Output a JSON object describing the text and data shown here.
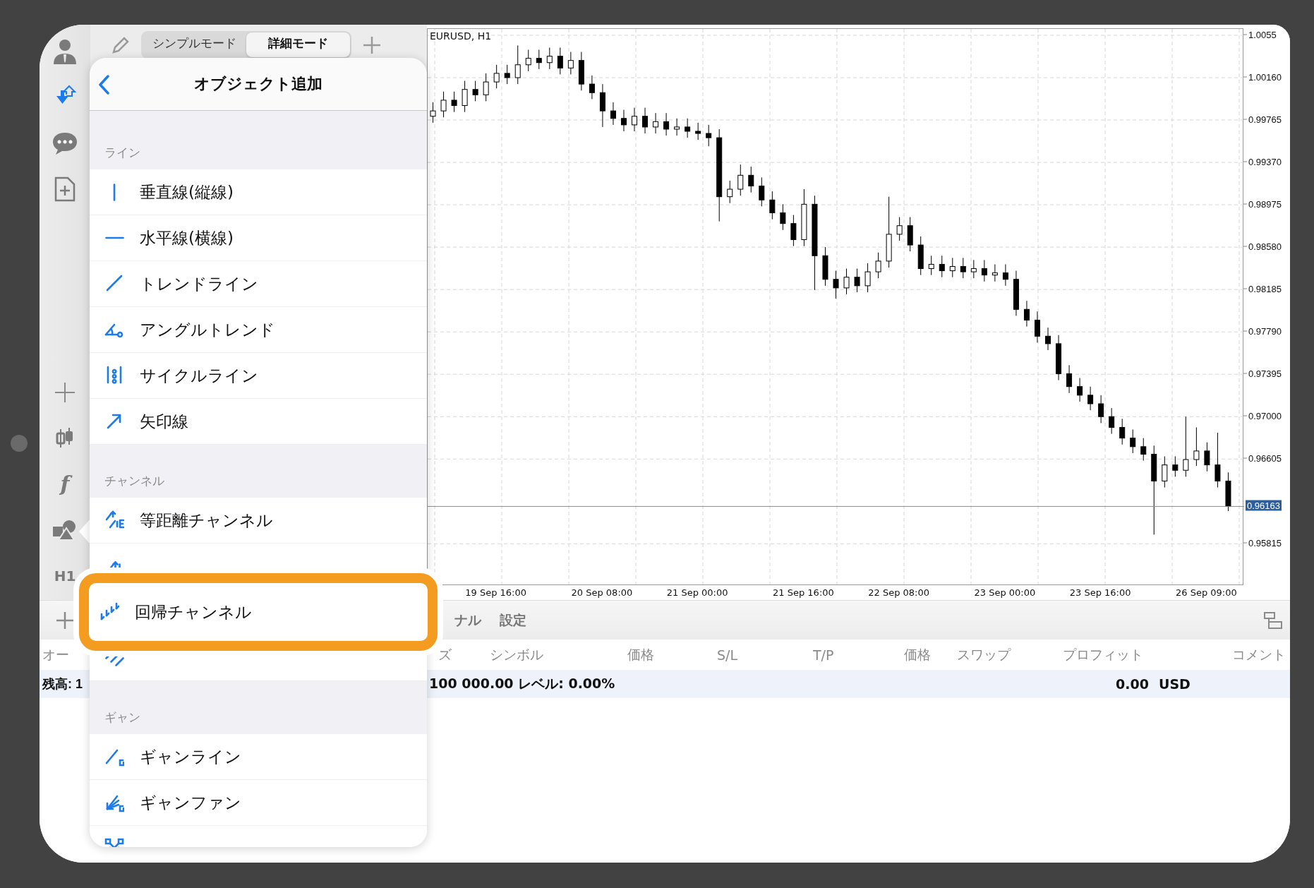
{
  "sidebar": {
    "function_glyph": "f",
    "timeframe": "H1"
  },
  "mode_tabs": [
    {
      "label": "シンプルモード",
      "selected": false
    },
    {
      "label": "詳細モード",
      "selected": true
    }
  ],
  "menu": {
    "title": "オブジェクト追加",
    "sections": [
      {
        "header": "ライン",
        "items": [
          {
            "label": "垂直線(縦線)",
            "highlighted": false
          },
          {
            "label": "水平線(横線)",
            "highlighted": false
          },
          {
            "label": "トレンドライン",
            "highlighted": false
          },
          {
            "label": "アングルトレンド",
            "highlighted": false
          },
          {
            "label": "サイクルライン",
            "highlighted": false
          },
          {
            "label": "矢印線",
            "highlighted": false
          }
        ]
      },
      {
        "header": "チャンネル",
        "items": [
          {
            "label": "等距離チャンネル",
            "highlighted": false
          },
          {
            "highlighted": false
          },
          {
            "label": "回帰チャンネル",
            "highlighted": true
          },
          {
            "highlighted": false
          }
        ]
      },
      {
        "header": "ギャン",
        "items": [
          {
            "label": "ギャンライン",
            "highlighted": false
          },
          {
            "label": "ギャンファン",
            "highlighted": false
          },
          {
            "highlighted": false
          }
        ]
      }
    ]
  },
  "chart": {
    "title": "EURUSD, H1",
    "chart_data": {
      "type": "candlestick",
      "categories": [
        null,
        null,
        null,
        null,
        null,
        null,
        "19 Sep 16:00",
        null,
        null,
        null,
        null,
        null,
        null,
        null,
        null,
        null,
        "20 Sep 08:00",
        null,
        null,
        null,
        null,
        null,
        null,
        null,
        null,
        "21 Sep 00:00",
        null,
        null,
        null,
        null,
        null,
        null,
        null,
        null,
        null,
        "21 Sep 16:00",
        null,
        null,
        null,
        null,
        null,
        null,
        null,
        null,
        "22 Sep 08:00",
        null,
        null,
        null,
        null,
        null,
        null,
        null,
        null,
        null,
        "23 Sep 00:00",
        null,
        null,
        null,
        null,
        null,
        null,
        null,
        null,
        "23 Sep 16:00",
        null,
        null,
        null,
        null,
        null,
        null,
        null,
        null,
        null,
        "26 Sep 09:00",
        null,
        null
      ],
      "ohlc": [
        [
          0.998,
          0.9993,
          0.9974,
          0.9985
        ],
        [
          0.9985,
          1.0003,
          0.9979,
          0.9995
        ],
        [
          0.9995,
          1.0003,
          0.9984,
          0.999
        ],
        [
          0.999,
          1.0013,
          0.9984,
          1.0005
        ],
        [
          1.0005,
          1.0013,
          0.9994,
          1.0
        ],
        [
          1.0,
          1.002,
          0.9994,
          1.0012
        ],
        [
          1.0012,
          1.0028,
          1.0006,
          1.002
        ],
        [
          1.002,
          1.0028,
          1.001,
          1.0016
        ],
        [
          1.0016,
          1.0046,
          1.001,
          1.0028
        ],
        [
          1.0028,
          1.0042,
          1.0022,
          1.0034
        ],
        [
          1.0034,
          1.0042,
          1.0024,
          1.003
        ],
        [
          1.003,
          1.0044,
          1.0024,
          1.0036
        ],
        [
          1.0036,
          1.0044,
          1.0019,
          1.0025
        ],
        [
          1.0025,
          1.004,
          1.0019,
          1.0032
        ],
        [
          1.0032,
          1.004,
          1.0004,
          1.001
        ],
        [
          1.001,
          1.0018,
          0.9996,
          1.0002
        ],
        [
          1.0002,
          1.001,
          0.997,
          0.9985
        ],
        [
          0.9985,
          0.9993,
          0.9972,
          0.9978
        ],
        [
          0.9978,
          0.9986,
          0.9966,
          0.9972
        ],
        [
          0.9972,
          0.9988,
          0.9966,
          0.998
        ],
        [
          0.998,
          0.9988,
          0.9964,
          0.997
        ],
        [
          0.997,
          0.9983,
          0.9964,
          0.9975
        ],
        [
          0.9975,
          0.9983,
          0.9962,
          0.9968
        ],
        [
          0.9968,
          0.9978,
          0.9962,
          0.997
        ],
        [
          0.997,
          0.9978,
          0.996,
          0.9966
        ],
        [
          0.9966,
          0.9974,
          0.9958,
          0.9964
        ],
        [
          0.9964,
          0.9972,
          0.9952,
          0.996
        ],
        [
          0.996,
          0.9968,
          0.9882,
          0.9905
        ],
        [
          0.9905,
          0.992,
          0.9899,
          0.9912
        ],
        [
          0.9912,
          0.9935,
          0.9906,
          0.9925
        ],
        [
          0.9925,
          0.9933,
          0.9909,
          0.9915
        ],
        [
          0.9915,
          0.9923,
          0.9896,
          0.9902
        ],
        [
          0.9902,
          0.991,
          0.9884,
          0.989
        ],
        [
          0.989,
          0.9898,
          0.9874,
          0.988
        ],
        [
          0.988,
          0.9888,
          0.9859,
          0.9865
        ],
        [
          0.9865,
          0.9912,
          0.9859,
          0.9898
        ],
        [
          0.9898,
          0.9906,
          0.9818,
          0.985
        ],
        [
          0.985,
          0.9858,
          0.9822,
          0.9828
        ],
        [
          0.9828,
          0.9836,
          0.981,
          0.982
        ],
        [
          0.982,
          0.9838,
          0.9814,
          0.983
        ],
        [
          0.983,
          0.9838,
          0.9816,
          0.9822
        ],
        [
          0.9822,
          0.9843,
          0.9816,
          0.9835
        ],
        [
          0.9835,
          0.9853,
          0.9829,
          0.9845
        ],
        [
          0.9845,
          0.9905,
          0.9839,
          0.987
        ],
        [
          0.987,
          0.9886,
          0.9864,
          0.9878
        ],
        [
          0.9878,
          0.9886,
          0.9854,
          0.986
        ],
        [
          0.986,
          0.9868,
          0.9832,
          0.9838
        ],
        [
          0.9838,
          0.985,
          0.9832,
          0.9842
        ],
        [
          0.9842,
          0.985,
          0.983,
          0.9836
        ],
        [
          0.9836,
          0.9848,
          0.983,
          0.984
        ],
        [
          0.984,
          0.9848,
          0.9829,
          0.9835
        ],
        [
          0.9835,
          0.9846,
          0.9829,
          0.9838
        ],
        [
          0.9838,
          0.9846,
          0.9826,
          0.9832
        ],
        [
          0.9832,
          0.9842,
          0.9826,
          0.9834
        ],
        [
          0.9834,
          0.9842,
          0.9822,
          0.9828
        ],
        [
          0.9828,
          0.9836,
          0.9794,
          0.98
        ],
        [
          0.98,
          0.9808,
          0.9784,
          0.979
        ],
        [
          0.979,
          0.9798,
          0.9769,
          0.9775
        ],
        [
          0.9775,
          0.9783,
          0.9762,
          0.9768
        ],
        [
          0.9768,
          0.9776,
          0.9734,
          0.974
        ],
        [
          0.974,
          0.9748,
          0.9722,
          0.9728
        ],
        [
          0.9728,
          0.9736,
          0.9714,
          0.972
        ],
        [
          0.972,
          0.9728,
          0.9706,
          0.9712
        ],
        [
          0.9712,
          0.972,
          0.9694,
          0.97
        ],
        [
          0.97,
          0.9708,
          0.9684,
          0.969
        ],
        [
          0.969,
          0.9698,
          0.9674,
          0.968
        ],
        [
          0.968,
          0.9688,
          0.9666,
          0.9672
        ],
        [
          0.9672,
          0.968,
          0.9659,
          0.9665
        ],
        [
          0.9665,
          0.9673,
          0.959,
          0.964
        ],
        [
          0.964,
          0.9663,
          0.9634,
          0.9655
        ],
        [
          0.9655,
          0.9663,
          0.9644,
          0.965
        ],
        [
          0.965,
          0.97,
          0.9644,
          0.966
        ],
        [
          0.966,
          0.969,
          0.9654,
          0.9668
        ],
        [
          0.9668,
          0.9676,
          0.9649,
          0.9655
        ],
        [
          0.9655,
          0.9685,
          0.9634,
          0.964
        ],
        [
          0.964,
          0.9648,
          0.9612,
          0.96163
        ]
      ],
      "ylim": [
        0.95429,
        1.00614
      ],
      "grid": true,
      "yticks": [
        {
          "value": 1.00555,
          "label": "1.0055"
        },
        {
          "value": 1.0016,
          "label": "1.00160"
        },
        {
          "value": 0.99765,
          "label": "0.99765"
        },
        {
          "value": 0.9937,
          "label": "0.99370"
        },
        {
          "value": 0.98975,
          "label": "0.98975"
        },
        {
          "value": 0.9858,
          "label": "0.98580"
        },
        {
          "value": 0.98185,
          "label": "0.98185"
        },
        {
          "value": 0.9779,
          "label": "0.97790"
        },
        {
          "value": 0.97395,
          "label": "0.97395"
        },
        {
          "value": 0.97,
          "label": "0.97000"
        },
        {
          "value": 0.96605,
          "label": "0.96605"
        },
        {
          "value": 0.95815,
          "label": "0.95815"
        }
      ],
      "ref_lines": [
        {
          "axis": "y",
          "value": 0.96163,
          "label": "0.96163"
        }
      ]
    }
  },
  "bottom_panel": {
    "tabs": [
      "ナル",
      "設定"
    ],
    "columns": [
      "オー",
      "ズ",
      "シンボル",
      "価格",
      "S/L",
      "T/P",
      "価格",
      "スワップ",
      "プロフィット",
      "コメント"
    ],
    "balance": {
      "left": "残高: 1",
      "summary": "100 000.00 レベル: 0.00%",
      "profit": "0.00",
      "currency": "USD"
    }
  }
}
